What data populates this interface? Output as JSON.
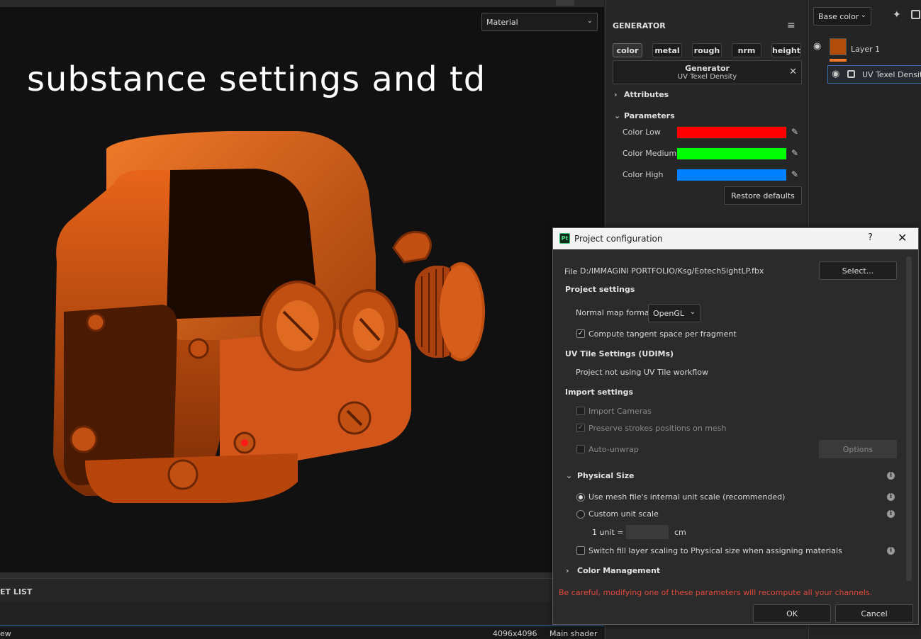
{
  "viewport": {
    "view_select": "Material",
    "overlay_title": "substance settings and td"
  },
  "bottom": {
    "asset_list_label": "ET LIST",
    "status_left": "ew",
    "resolution": "4096x4096",
    "shader": "Main shader"
  },
  "generator": {
    "title": "GENERATOR",
    "channels": [
      "color",
      "metal",
      "rough",
      "nrm",
      "height"
    ],
    "box_title": "Generator",
    "box_subtitle": "UV Texel Density",
    "attributes_label": "Attributes",
    "parameters_label": "Parameters",
    "params": [
      {
        "label": "Color Low",
        "color": "#ff0000"
      },
      {
        "label": "Color Medium",
        "color": "#00ff00"
      },
      {
        "label": "Color High",
        "color": "#0080ff"
      }
    ],
    "restore_label": "Restore defaults"
  },
  "layers": {
    "channel_select": "Base color",
    "layer1_name": "Layer 1",
    "layer1_color": "#b04d0a",
    "layer2_name": "UV Texel Density"
  },
  "dialog": {
    "title": "Project configuration",
    "app_icon": "Pt",
    "help": "?",
    "file_label": "File",
    "file_path": "D:/IMMAGINI PORTFOLIO/Ksg/EotechSightLP.fbx",
    "select_label": "Select...",
    "project_settings": "Project settings",
    "normal_map_label": "Normal map format",
    "normal_map_value": "OpenGL",
    "tangent_label": "Compute tangent space per fragment",
    "udim_heading": "UV Tile Settings (UDIMs)",
    "udim_text": "Project not using UV Tile workflow",
    "import_heading": "Import settings",
    "import_cameras": "Import Cameras",
    "preserve_strokes": "Preserve strokes positions on mesh",
    "auto_unwrap": "Auto-unwrap",
    "options_label": "Options",
    "physical_heading": "Physical Size",
    "use_mesh_scale": "Use mesh file's internal unit scale (recommended)",
    "custom_scale": "Custom unit scale",
    "unit_label": "1 unit =",
    "unit_suffix": "cm",
    "switch_fill": "Switch fill layer scaling to Physical size when assigning materials",
    "color_mgmt": "Color Management",
    "warning": "Be careful, modifying one of these parameters will recompute all your channels.",
    "ok_label": "OK",
    "cancel_label": "Cancel"
  }
}
